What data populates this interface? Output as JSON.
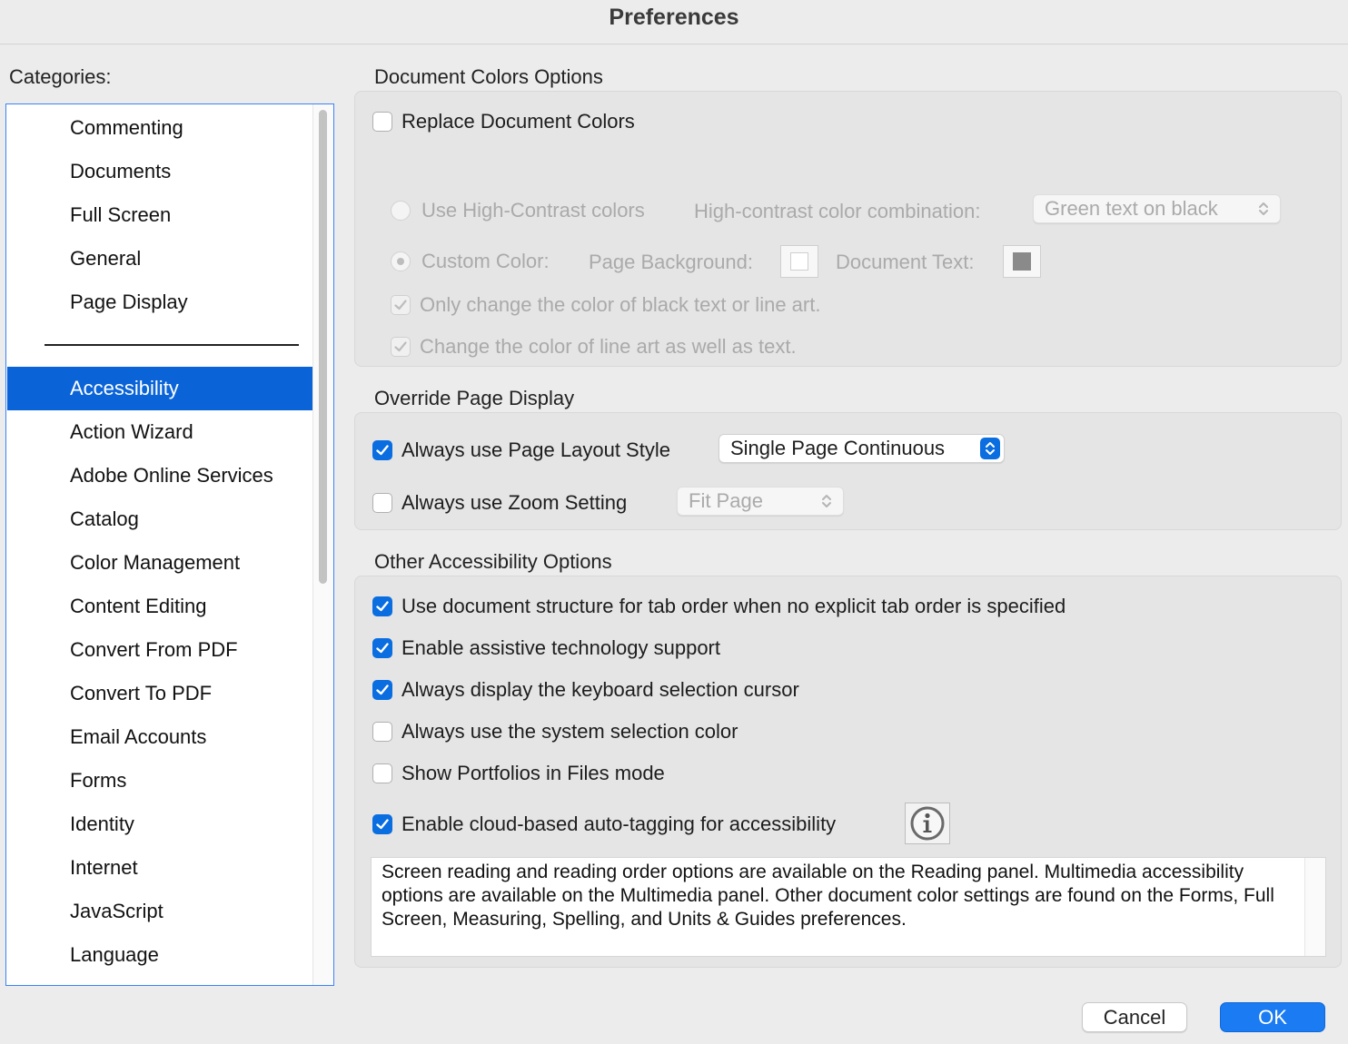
{
  "window": {
    "title": "Preferences"
  },
  "sidebar": {
    "label": "Categories:",
    "items_top": [
      "Commenting",
      "Documents",
      "Full Screen",
      "General",
      "Page Display"
    ],
    "items_bottom": [
      "Accessibility",
      "Action Wizard",
      "Adobe Online Services",
      "Catalog",
      "Color Management",
      "Content Editing",
      "Convert From PDF",
      "Convert To PDF",
      "Email Accounts",
      "Forms",
      "Identity",
      "Internet",
      "JavaScript",
      "Language"
    ],
    "selected": "Accessibility"
  },
  "document_colors": {
    "title": "Document Colors Options",
    "replace_label": "Replace Document Colors",
    "replace_checked": false,
    "high_contrast_label": "Use High-Contrast colors",
    "combination_label": "High-contrast color combination:",
    "combination_value": "Green text on black",
    "custom_color_label": "Custom Color:",
    "page_background_label": "Page Background:",
    "document_text_label": "Document Text:",
    "page_background_color": "#ffffff",
    "document_text_color": "#8a8a8a",
    "only_black_label": "Only change the color of black text or line art.",
    "line_art_label": "Change the color of line art as well as text."
  },
  "override": {
    "title": "Override Page Display",
    "layout_label": "Always use Page Layout Style",
    "layout_checked": true,
    "layout_value": "Single Page Continuous",
    "zoom_label": "Always use Zoom Setting",
    "zoom_checked": false,
    "zoom_value": "Fit Page"
  },
  "other": {
    "title": "Other Accessibility Options",
    "options": [
      {
        "label": "Use document structure for tab order when no explicit tab order is specified",
        "checked": true
      },
      {
        "label": "Enable assistive technology support",
        "checked": true
      },
      {
        "label": "Always display the keyboard selection cursor",
        "checked": true
      },
      {
        "label": "Always use the system selection color",
        "checked": false
      },
      {
        "label": "Show Portfolios in Files mode",
        "checked": false
      },
      {
        "label": "Enable cloud-based auto-tagging for accessibility",
        "checked": true
      }
    ],
    "info_icon": "info-icon",
    "note": "Screen reading and reading order options are available on the Reading panel. Multimedia accessibility options are available on the Multimedia panel. Other document color settings are found on the Forms, Full Screen, Measuring, Spelling, and Units & Guides preferences."
  },
  "buttons": {
    "cancel": "Cancel",
    "ok": "OK"
  },
  "colors": {
    "accent": "#0a6de0",
    "selection": "#0a64d8"
  }
}
